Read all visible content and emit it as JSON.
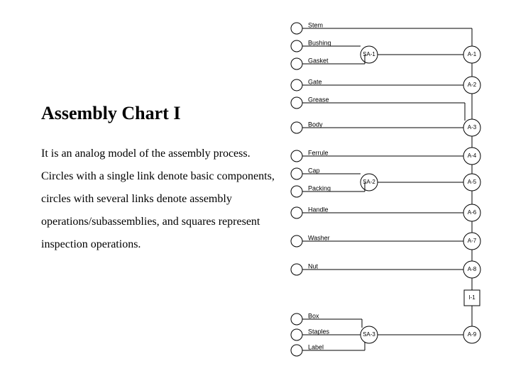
{
  "title": "Assembly Chart I",
  "body": "It is an analog model of the assembly process. Circles with a single link denote basic components, circles with several links denote assembly operations/subassemblies, and squares represent inspection operations.",
  "diagram": {
    "components": [
      {
        "label": "Stem"
      },
      {
        "label": "Bushing"
      },
      {
        "label": "Gasket"
      },
      {
        "label": "Gate"
      },
      {
        "label": "Grease"
      },
      {
        "label": "Body"
      },
      {
        "label": "Ferrule"
      },
      {
        "label": "Cap"
      },
      {
        "label": "Packing"
      },
      {
        "label": "Handle"
      },
      {
        "label": "Washer"
      },
      {
        "label": "Nut"
      },
      {
        "label": "Box"
      },
      {
        "label": "Staples"
      },
      {
        "label": "Label"
      }
    ],
    "subassemblies": [
      {
        "label": "SA-1"
      },
      {
        "label": "SA-2"
      },
      {
        "label": "SA-3"
      }
    ],
    "assemblies": [
      {
        "label": "A-1"
      },
      {
        "label": "A-2"
      },
      {
        "label": "A-3"
      },
      {
        "label": "A-4"
      },
      {
        "label": "A-5"
      },
      {
        "label": "A-6"
      },
      {
        "label": "A-7"
      },
      {
        "label": "A-8"
      },
      {
        "label": "A-9"
      }
    ],
    "inspections": [
      {
        "label": "I-1"
      }
    ]
  }
}
